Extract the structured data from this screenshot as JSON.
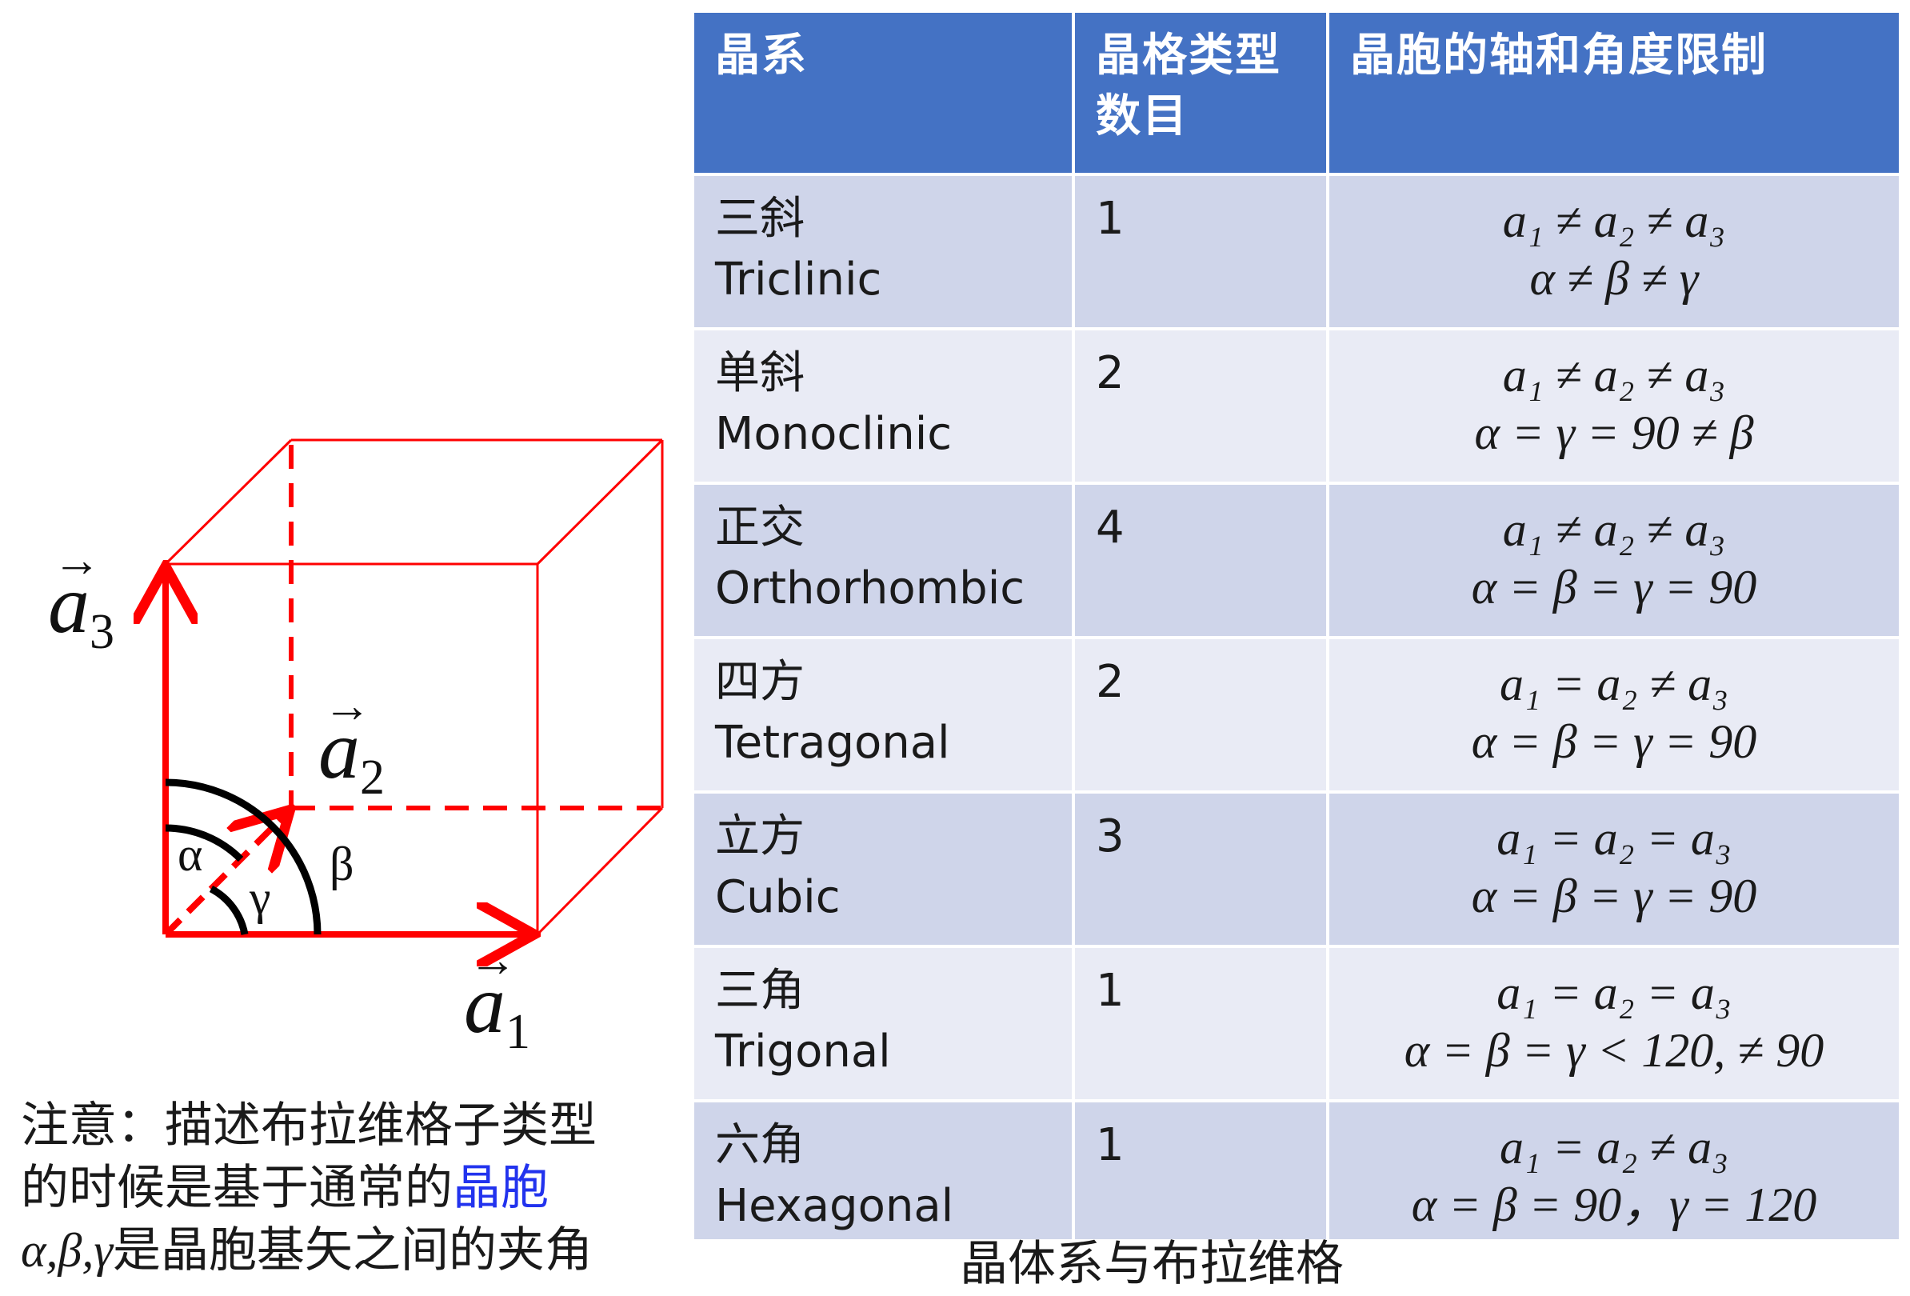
{
  "diagram": {
    "vector_labels": {
      "a1": {
        "letter": "a",
        "subscript": "1"
      },
      "a2": {
        "letter": "a",
        "subscript": "2"
      },
      "a3": {
        "letter": "a",
        "subscript": "3"
      }
    },
    "angle_labels": {
      "alpha": "α",
      "beta": "β",
      "gamma": "γ"
    },
    "colors": {
      "edges": "#ff0000",
      "axes": "#ff0000",
      "arcs": "#000000"
    }
  },
  "note": {
    "line1": "注意：描述布拉维格子类型",
    "line2_prefix": "的时候是基于通常的",
    "line2_highlight": "晶胞",
    "line3_greek": "α,β,γ",
    "line3_text": "是晶胞基矢之间的夹角"
  },
  "table": {
    "headers": [
      "晶系",
      "晶格类型数目",
      "晶胞的轴和角度限制"
    ],
    "rows": [
      {
        "zh": "三斜",
        "en": "Triclinic",
        "count": "1",
        "axes": "a₁ ≠ a₂ ≠ a₃",
        "angles": "α ≠ β ≠ γ"
      },
      {
        "zh": "单斜",
        "en": "Monoclinic",
        "count": "2",
        "axes": "a₁ ≠ a₂ ≠ a₃",
        "angles": "α = γ = 90 ≠ β"
      },
      {
        "zh": "正交",
        "en": "Orthorhombic",
        "count": "4",
        "axes": "a₁ ≠ a₂ ≠ a₃",
        "angles": "α = β = γ = 90"
      },
      {
        "zh": "四方",
        "en": "Tetragonal",
        "count": "2",
        "axes": "a₁ = a₂ ≠ a₃",
        "angles": "α = β = γ = 90"
      },
      {
        "zh": "立方",
        "en": "Cubic",
        "count": "3",
        "axes": "a₁ = a₂ = a₃",
        "angles": "α = β = γ = 90"
      },
      {
        "zh": "三角",
        "en": "Trigonal",
        "count": "1",
        "axes": "a₁ = a₂ = a₃",
        "angles": "α = β = γ < 120, ≠ 90"
      },
      {
        "zh": "六角",
        "en": "Hexagonal",
        "count": "1",
        "axes": "a₁ = a₂ ≠ a₃",
        "angles": "α = β = 90，γ = 120"
      }
    ],
    "colors": {
      "header": "#4472c4",
      "row_odd": "#cfd5ea",
      "row_even": "#e9ebf5"
    }
  },
  "caption": "晶体系与布拉维格"
}
